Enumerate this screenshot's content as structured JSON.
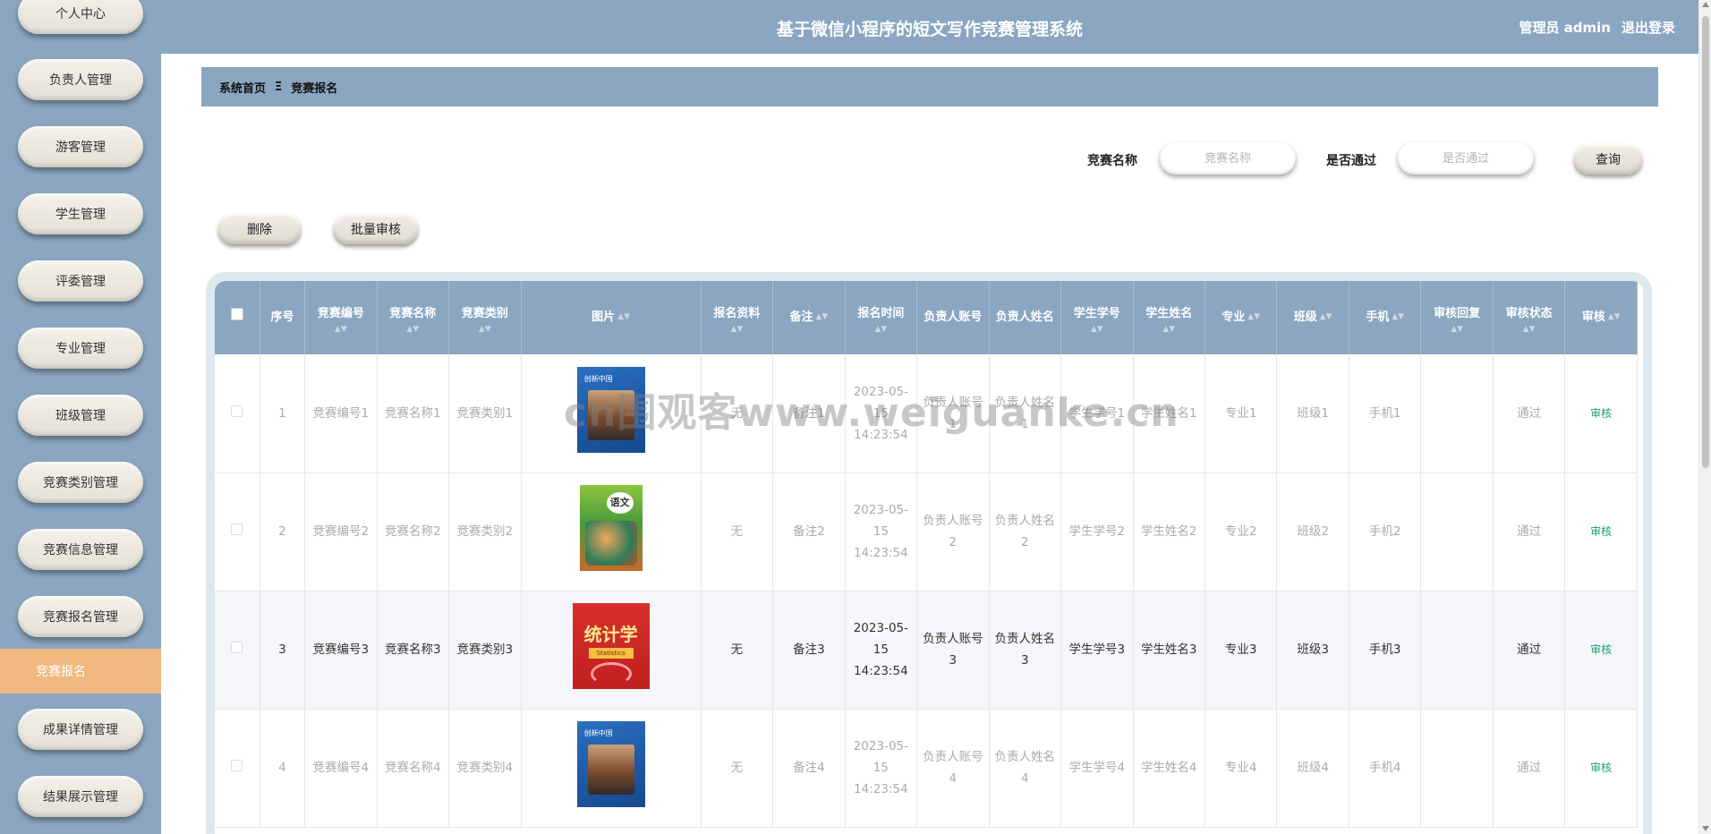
{
  "header": {
    "title": "基于微信小程序的短文写作竞赛管理系统",
    "user_label": "管理员 admin",
    "logout_label": "退出登录"
  },
  "sidebar": {
    "items": [
      {
        "label": "个人中心"
      },
      {
        "label": "负责人管理"
      },
      {
        "label": "游客管理"
      },
      {
        "label": "学生管理"
      },
      {
        "label": "评委管理"
      },
      {
        "label": "专业管理"
      },
      {
        "label": "班级管理"
      },
      {
        "label": "竞赛类别管理"
      },
      {
        "label": "竞赛信息管理"
      },
      {
        "label": "竞赛报名管理"
      },
      {
        "label": "成果详情管理"
      },
      {
        "label": "结果展示管理"
      }
    ],
    "active_sub": "竞赛报名"
  },
  "breadcrumb": {
    "home": "系统首页",
    "separator": "Ξ",
    "current": "竞赛报名"
  },
  "search": {
    "name_label": "竞赛名称",
    "name_placeholder": "竞赛名称",
    "pass_label": "是否通过",
    "pass_placeholder": "是否通过",
    "query_button": "查询"
  },
  "actions": {
    "delete_button": "删除",
    "batch_review_button": "批量审核"
  },
  "table": {
    "headers": [
      "序号",
      "竞赛编号",
      "竞赛名称",
      "竞赛类别",
      "图片",
      "报名资料",
      "备注",
      "报名时间",
      "负责人账号",
      "负责人姓名",
      "学生学号",
      "学生姓名",
      "专业",
      "班级",
      "手机",
      "审核回复",
      "审核状态",
      "审核"
    ],
    "rows": [
      {
        "index": "1",
        "code": "竞赛编号1",
        "name": "竞赛名称1",
        "category": "竞赛类别1",
        "cover": "blue",
        "material": "无",
        "note": "备注1",
        "time": "2023-05-15 14:23:54",
        "leader_account": "负责人账号1",
        "leader_name": "负责人姓名1",
        "student_no": "学生学号1",
        "student_name": "学生姓名1",
        "major": "专业1",
        "class": "班级1",
        "phone": "手机1",
        "reply": "",
        "status": "通过",
        "review": "审核"
      },
      {
        "index": "2",
        "code": "竞赛编号2",
        "name": "竞赛名称2",
        "category": "竞赛类别2",
        "cover": "green",
        "material": "无",
        "note": "备注2",
        "time": "2023-05-15 14:23:54",
        "leader_account": "负责人账号2",
        "leader_name": "负责人姓名2",
        "student_no": "学生学号2",
        "student_name": "学生姓名2",
        "major": "专业2",
        "class": "班级2",
        "phone": "手机2",
        "reply": "",
        "status": "通过",
        "review": "审核"
      },
      {
        "index": "3",
        "code": "竞赛编号3",
        "name": "竞赛名称3",
        "category": "竞赛类别3",
        "cover": "red",
        "material": "无",
        "note": "备注3",
        "time": "2023-05-15 14:23:54",
        "leader_account": "负责人账号3",
        "leader_name": "负责人姓名3",
        "student_no": "学生学号3",
        "student_name": "学生姓名3",
        "major": "专业3",
        "class": "班级3",
        "phone": "手机3",
        "reply": "",
        "status": "通过",
        "review": "审核"
      },
      {
        "index": "4",
        "code": "竞赛编号4",
        "name": "竞赛名称4",
        "category": "竞赛类别4",
        "cover": "blue",
        "material": "无",
        "note": "备注4",
        "time": "2023-05-15 14:23:54",
        "leader_account": "负责人账号4",
        "leader_name": "负责人姓名4",
        "student_no": "学生学号4",
        "student_name": "学生姓名4",
        "major": "专业4",
        "class": "班级4",
        "phone": "手机4",
        "reply": "",
        "status": "通过",
        "review": "审核"
      }
    ]
  },
  "covers": {
    "blue_title": "创新中国",
    "green_title": "语文",
    "red_title": "统计学",
    "red_sub": "Statistics"
  },
  "watermark": "cn围观客www.weiguanke.cn",
  "colors": {
    "primary": "#8aa6c1",
    "active_menu": "#f0b97f",
    "review_link": "#19a06e"
  }
}
